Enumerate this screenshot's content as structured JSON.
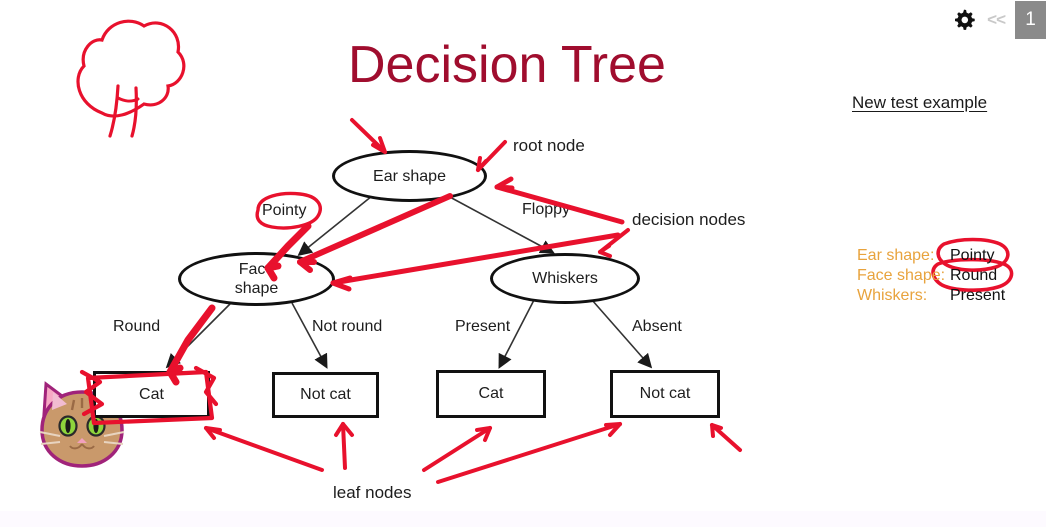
{
  "window": {
    "controls": {
      "gear_icon": "gear-icon",
      "collapse_label": "<<",
      "page_number": "1"
    }
  },
  "slide": {
    "title": "Decision Tree",
    "title_color": "#a00d2e",
    "ink_color": "#e8112d",
    "doodle": "hand-drawn-tree-doodle",
    "cat_image": "cartoon-cat-face"
  },
  "tree": {
    "nodes": [
      {
        "id": "root",
        "label": "Ear shape",
        "shape": "ellipse"
      },
      {
        "id": "face",
        "label": "Face\nshape",
        "shape": "ellipse"
      },
      {
        "id": "whiskers",
        "label": "Whiskers",
        "shape": "ellipse"
      },
      {
        "id": "leaf1",
        "label": "Cat",
        "shape": "rect"
      },
      {
        "id": "leaf2",
        "label": "Not cat",
        "shape": "rect"
      },
      {
        "id": "leaf3",
        "label": "Cat",
        "shape": "rect"
      },
      {
        "id": "leaf4",
        "label": "Not cat",
        "shape": "rect"
      }
    ],
    "node_labels": {
      "root": "Ear shape",
      "face_line1": "Face",
      "face_line2": "shape",
      "whiskers": "Whiskers",
      "leaf1": "Cat",
      "leaf2": "Not cat",
      "leaf3": "Cat",
      "leaf4": "Not cat"
    },
    "edge_labels": {
      "pointy": "Pointy",
      "floppy": "Floppy",
      "round": "Round",
      "not_round": "Not round",
      "present": "Present",
      "absent": "Absent"
    }
  },
  "annotations": {
    "root_node": "root node",
    "decision_nodes": "decision nodes",
    "leaf_nodes": "leaf nodes"
  },
  "panel": {
    "heading": "New test example",
    "attributes": [
      {
        "label": "Ear shape:",
        "value": "Pointy",
        "circled": true
      },
      {
        "label": "Face shape:",
        "value": "Round",
        "circled": true
      },
      {
        "label": "Whiskers:",
        "value": "Present",
        "circled": false
      }
    ]
  },
  "colors": {
    "title": "#a00d2e",
    "ink": "#e8112d",
    "attribute_label": "#e8a33d",
    "node_stroke": "#111111",
    "chip_background": "#8a8a8a"
  }
}
